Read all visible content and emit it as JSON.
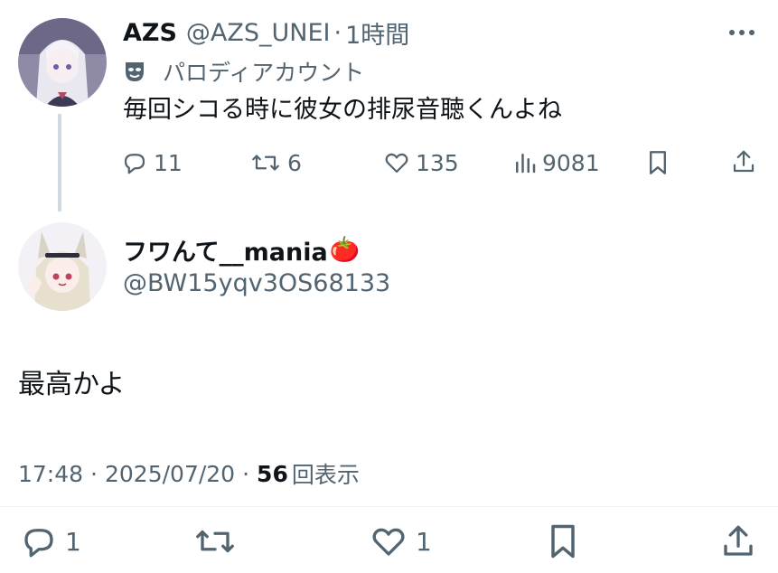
{
  "parent": {
    "name": "AZS",
    "handle": "@AZS_UNEI",
    "sep": "·",
    "time": "1時間",
    "badge_icon": "theater-mask-icon",
    "badge_text": "パロディアカウント",
    "text": "毎回シコる時に彼女の排尿音聴くんよね",
    "more_icon": "more-dots-icon",
    "actions": {
      "replies": "11",
      "retweets": "6",
      "likes": "135",
      "views": "9081"
    }
  },
  "reply": {
    "name": "フワんて__mania",
    "emoji": "🍅",
    "handle": "@BW15yqv3OS68133",
    "text": "最高かよ",
    "meta": {
      "time": "17:48",
      "sep1": "·",
      "date": "2025/07/20",
      "sep2": "·",
      "views_count": "56",
      "views_label": "回表示"
    },
    "actions": {
      "replies": "1",
      "likes": "1"
    }
  },
  "colors": {
    "text": "#0f1419",
    "muted": "#536471",
    "thread_line": "#cfd9de"
  }
}
